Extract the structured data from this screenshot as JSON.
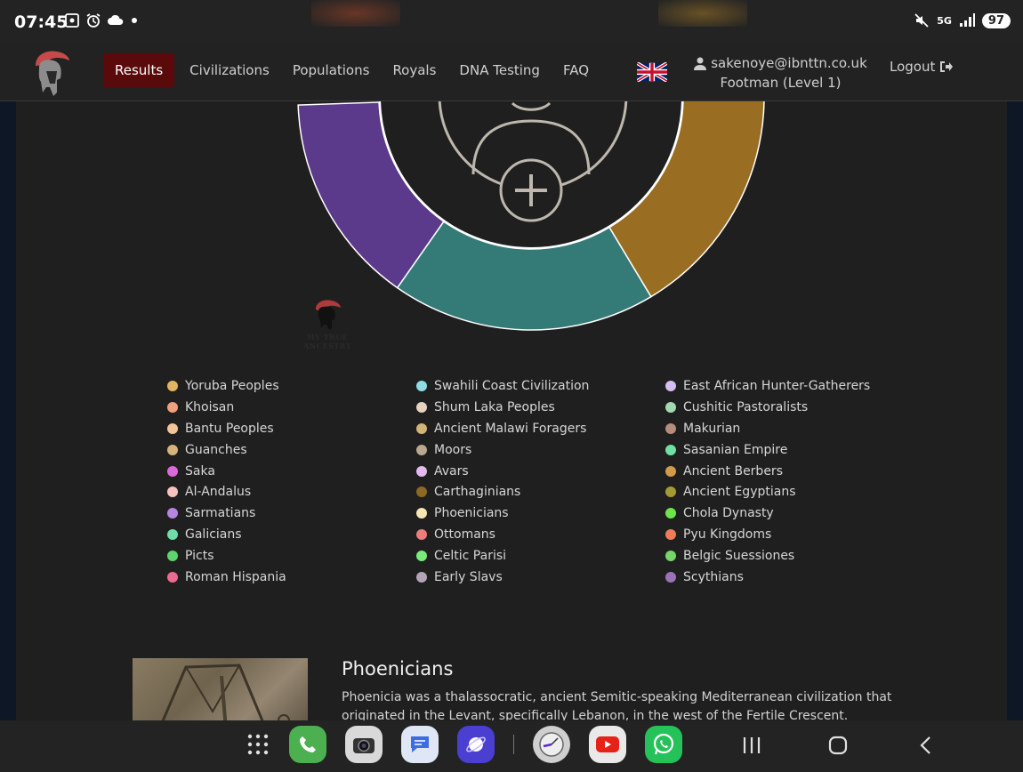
{
  "status_bar": {
    "time": "07:45",
    "network": "5G",
    "battery": "97",
    "left_icons": [
      "screenshot-icon",
      "alarm-icon",
      "cloud-icon",
      "dot-icon"
    ],
    "right_icons": [
      "mute-icon",
      "5g-icon",
      "signal-icon",
      "battery-icon"
    ]
  },
  "header": {
    "nav": [
      {
        "label": "Results",
        "active": true
      },
      {
        "label": "Civilizations",
        "active": false
      },
      {
        "label": "Populations",
        "active": false
      },
      {
        "label": "Royals",
        "active": false
      },
      {
        "label": "DNA Testing",
        "active": false
      },
      {
        "label": "FAQ",
        "active": false
      }
    ],
    "user_email": "sakenoye@ibnttn.co.uk",
    "user_level": "Footman (Level 1)",
    "logout_label": "Logout"
  },
  "chart_data": {
    "type": "pie",
    "style": "donut",
    "visible_segments": [
      {
        "color": "#5b3a8c"
      },
      {
        "color": "#347b78"
      },
      {
        "color": "#9a6e22"
      }
    ]
  },
  "watermark_text": "MY TRUE ANCESTRY",
  "legend": {
    "columns": [
      [
        {
          "label": "Yoruba Peoples",
          "color": "#e3b461"
        },
        {
          "label": "Khoisan",
          "color": "#efa07e"
        },
        {
          "label": "Bantu Peoples",
          "color": "#f2c49a"
        },
        {
          "label": "Guanches",
          "color": "#d6b37c"
        },
        {
          "label": "Saka",
          "color": "#d96ad9"
        },
        {
          "label": "Al-Andalus",
          "color": "#f4c4bd"
        },
        {
          "label": "Sarmatians",
          "color": "#b585e0"
        },
        {
          "label": "Galicians",
          "color": "#6fdcaa"
        },
        {
          "label": "Picts",
          "color": "#5ed46e"
        },
        {
          "label": "Roman Hispania",
          "color": "#ec6b92"
        }
      ],
      [
        {
          "label": "Swahili Coast Civilization",
          "color": "#8fdce4"
        },
        {
          "label": "Shum Laka Peoples",
          "color": "#e6d3bf"
        },
        {
          "label": "Ancient Malawi Foragers",
          "color": "#d0b577"
        },
        {
          "label": "Moors",
          "color": "#b8a98f"
        },
        {
          "label": "Avars",
          "color": "#e3b9ef"
        },
        {
          "label": "Carthaginians",
          "color": "#8c6a23"
        },
        {
          "label": "Phoenicians",
          "color": "#f6e6b2"
        },
        {
          "label": "Ottomans",
          "color": "#ec7d7d"
        },
        {
          "label": "Celtic Parisi",
          "color": "#78ec78"
        },
        {
          "label": "Early Slavs",
          "color": "#b3a3b8"
        }
      ],
      [
        {
          "label": "East African Hunter-Gatherers",
          "color": "#d4bdf1"
        },
        {
          "label": "Cushitic Pastoralists",
          "color": "#a4d8b3"
        },
        {
          "label": "Makurian",
          "color": "#b68d7c"
        },
        {
          "label": "Sasanian Empire",
          "color": "#6ee1a0"
        },
        {
          "label": "Ancient Berbers",
          "color": "#d39a49"
        },
        {
          "label": "Ancient Egyptians",
          "color": "#a39a36"
        },
        {
          "label": "Chola Dynasty",
          "color": "#6ae64a"
        },
        {
          "label": "Pyu Kingdoms",
          "color": "#ee7c58"
        },
        {
          "label": "Belgic Suessiones",
          "color": "#77d567"
        },
        {
          "label": "Scythians",
          "color": "#9a72b6"
        }
      ]
    ]
  },
  "population": {
    "title": "Phoenicians",
    "description": "Phoenicia was a thalassocratic, ancient Semitic-speaking Mediterranean civilization that originated in the Levant, specifically Lebanon, in the west of the Fertile Crescent. Scholars"
  },
  "dock_apps": [
    "apps-grid-icon",
    "phone-icon",
    "camera-icon",
    "messages-icon",
    "browser-icon",
    "clock-icon",
    "youtube-icon",
    "whatsapp-icon"
  ],
  "system_nav": [
    "recents-icon",
    "home-icon",
    "back-icon"
  ]
}
